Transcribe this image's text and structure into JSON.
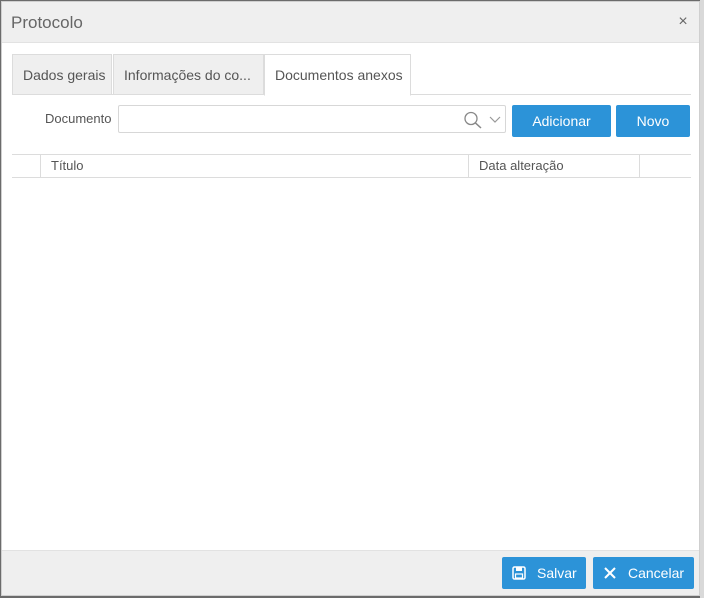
{
  "dialog": {
    "title": "Protocolo",
    "close_icon": "×"
  },
  "tabs": [
    {
      "label": "Dados gerais",
      "active": false
    },
    {
      "label": "Informações do co...",
      "active": false
    },
    {
      "label": "Documentos anexos",
      "active": true
    }
  ],
  "document": {
    "label": "Documento",
    "value": "",
    "placeholder": ""
  },
  "buttons": {
    "add": "Adicionar",
    "new": "Novo",
    "save": "Salvar",
    "cancel": "Cancelar"
  },
  "table": {
    "columns": [
      "",
      "Título",
      "Data alteração",
      ""
    ],
    "rows": []
  },
  "colors": {
    "accent": "#2c93d8",
    "header_bg": "#efefef"
  }
}
